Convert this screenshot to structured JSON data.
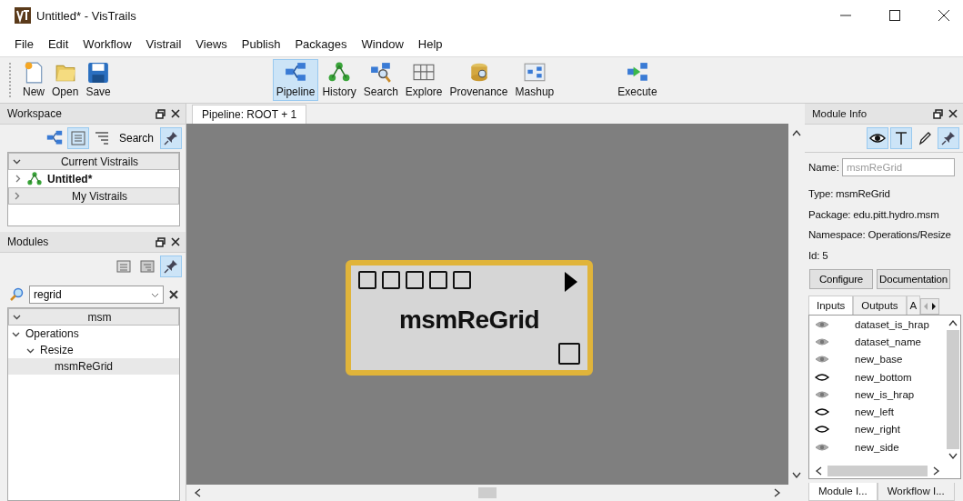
{
  "window": {
    "title": "Untitled* - VisTrails"
  },
  "menu": [
    "File",
    "Edit",
    "Workflow",
    "Vistrail",
    "Views",
    "Publish",
    "Packages",
    "Window",
    "Help"
  ],
  "toolbar": [
    {
      "label": "New",
      "kind": "new",
      "selected": false
    },
    {
      "label": "Open",
      "kind": "open",
      "selected": false
    },
    {
      "label": "Save",
      "kind": "save",
      "selected": false
    },
    {
      "label": "Pipeline",
      "kind": "pipeline",
      "selected": true
    },
    {
      "label": "History",
      "kind": "history",
      "selected": false
    },
    {
      "label": "Search",
      "kind": "search",
      "selected": false
    },
    {
      "label": "Explore",
      "kind": "explore",
      "selected": false
    },
    {
      "label": "Provenance",
      "kind": "provenance",
      "selected": false
    },
    {
      "label": "Mashup",
      "kind": "mashup",
      "selected": false
    },
    {
      "label": "Execute",
      "kind": "execute",
      "selected": false
    }
  ],
  "workspace": {
    "title": "Workspace",
    "tools": [
      {
        "kind": "pipeline",
        "selected": false
      },
      {
        "kind": "list",
        "selected": true
      },
      {
        "kind": "filter",
        "selected": false
      },
      {
        "kind": "text",
        "label": "Search",
        "selected": false
      },
      {
        "kind": "pin",
        "selected": true
      }
    ],
    "tree": [
      {
        "label": "Current Vistrails",
        "kind": "header",
        "expanded": true
      },
      {
        "label": "Untitled*",
        "kind": "item",
        "expanded": false
      },
      {
        "label": "My Vistrails",
        "kind": "header",
        "expanded": false
      }
    ]
  },
  "modules": {
    "title": "Modules",
    "tools": [
      {
        "kind": "collapse",
        "selected": false
      },
      {
        "kind": "expand",
        "selected": false
      },
      {
        "kind": "pin",
        "selected": true
      }
    ],
    "search": {
      "value": "regrid"
    },
    "tree": [
      {
        "label": "msm",
        "kind": "header",
        "expanded": true,
        "children": [
          {
            "label": "Operations",
            "kind": "item",
            "expanded": true,
            "selected": false,
            "children": [
              {
                "label": "Resize",
                "kind": "item",
                "expanded": true,
                "selected": false,
                "children": [
                  {
                    "label": "msmReGrid",
                    "kind": "item",
                    "selected": true
                  }
                ]
              }
            ]
          }
        ]
      }
    ]
  },
  "pipeline": {
    "tab": "Pipeline: ROOT + 1",
    "module": {
      "name": "msmReGrid",
      "selected": true
    }
  },
  "module_info": {
    "title": "Module Info",
    "tools": [
      {
        "kind": "eye",
        "selected": true
      },
      {
        "kind": "text",
        "selected": true
      },
      {
        "kind": "pencil",
        "selected": false
      },
      {
        "kind": "pin",
        "selected": true
      }
    ],
    "name_label": "Name:",
    "name_placeholder": "msmReGrid",
    "details": [
      "Type: msmReGrid",
      "Package: edu.pitt.hydro.msm",
      "Namespace: Operations/Resize",
      "Id: 5"
    ],
    "buttons": [
      "Configure",
      "Documentation"
    ],
    "tabs": [
      {
        "label": "Inputs",
        "selected": true
      },
      {
        "label": "Outputs",
        "selected": false
      },
      {
        "label": "A",
        "selected": false
      }
    ],
    "ports": [
      {
        "name": "dataset_is_hrap",
        "visible": false
      },
      {
        "name": "dataset_name",
        "visible": false
      },
      {
        "name": "new_base",
        "visible": false
      },
      {
        "name": "new_bottom",
        "visible": true
      },
      {
        "name": "new_is_hrap",
        "visible": false
      },
      {
        "name": "new_left",
        "visible": true
      },
      {
        "name": "new_right",
        "visible": true
      },
      {
        "name": "new_side",
        "visible": false
      }
    ],
    "bottom_tabs": [
      {
        "label": "Module I...",
        "selected": true
      },
      {
        "label": "Workflow I...",
        "selected": false
      }
    ]
  }
}
